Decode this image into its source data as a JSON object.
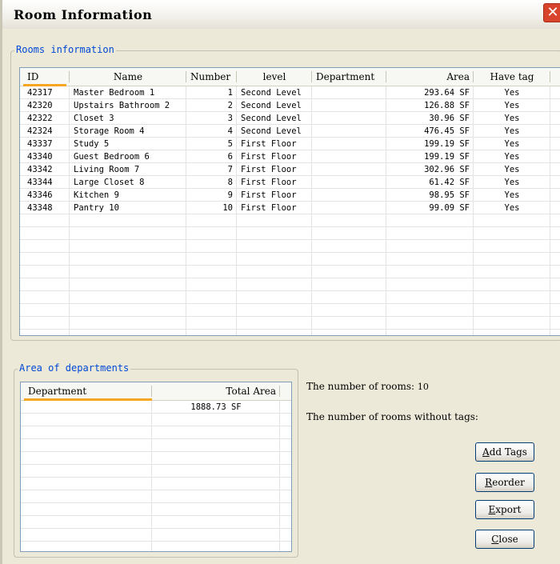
{
  "window": {
    "title": "Room Information",
    "close_glyph": "✕"
  },
  "rooms_group": {
    "legend": "Rooms information",
    "columns": [
      "ID",
      "Name",
      "Number",
      "level",
      "Department",
      "Area",
      "Have tag"
    ],
    "rows": [
      [
        "42317",
        "Master Bedroom 1",
        "1",
        "Second Level",
        "",
        "293.64 SF",
        "Yes"
      ],
      [
        "42320",
        "Upstairs Bathroom 2",
        "2",
        "Second Level",
        "",
        "126.88 SF",
        "Yes"
      ],
      [
        "42322",
        "Closet 3",
        "3",
        "Second Level",
        "",
        "30.96 SF",
        "Yes"
      ],
      [
        "42324",
        "Storage Room 4",
        "4",
        "Second Level",
        "",
        "476.45 SF",
        "Yes"
      ],
      [
        "43337",
        "Study 5",
        "5",
        "First Floor",
        "",
        "199.19 SF",
        "Yes"
      ],
      [
        "43340",
        "Guest Bedroom 6",
        "6",
        "First Floor",
        "",
        "199.19 SF",
        "Yes"
      ],
      [
        "43342",
        "Living Room 7",
        "7",
        "First Floor",
        "",
        "302.96 SF",
        "Yes"
      ],
      [
        "43344",
        "Large Closet 8",
        "8",
        "First Floor",
        "",
        "61.42 SF",
        "Yes"
      ],
      [
        "43346",
        "Kitchen 9",
        "9",
        "First Floor",
        "",
        "98.95 SF",
        "Yes"
      ],
      [
        "43348",
        "Pantry 10",
        "10",
        "First Floor",
        "",
        "99.09 SF",
        "Yes"
      ]
    ]
  },
  "departments_group": {
    "legend": "Area of departments",
    "columns": [
      "Department",
      "Total Area"
    ],
    "rows": [
      [
        "",
        "1888.73 SF"
      ]
    ]
  },
  "summary": {
    "rooms_count_label": "The number of rooms:",
    "rooms_count_value": "10",
    "rooms_without_tags_label": "The number of rooms without tags:",
    "rooms_without_tags_value": ""
  },
  "buttons": {
    "add_tags": {
      "mnemonic": "A",
      "rest": "dd Tags"
    },
    "reorder": {
      "mnemonic": "R",
      "rest": "eorder"
    },
    "export": {
      "mnemonic": "E",
      "rest": "xport"
    },
    "close": {
      "mnemonic": "C",
      "rest": "lose"
    }
  },
  "colors": {
    "legend_text": "#0048d6",
    "header_underline": "#f5a623",
    "close_button": "#d8432b",
    "window_bg": "#ece9d8"
  }
}
